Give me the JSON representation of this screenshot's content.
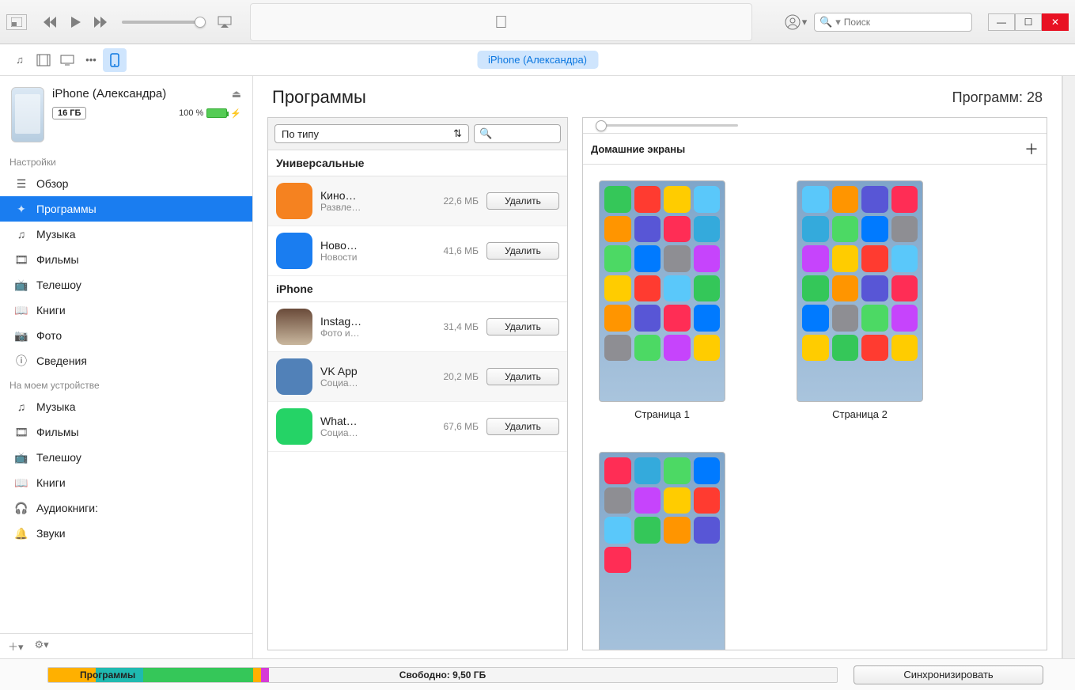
{
  "search_placeholder": "Поиск",
  "device_pill": "iPhone (Александра)",
  "device": {
    "name": "iPhone (Александра)",
    "storage": "16 ГБ",
    "battery_pct": "100 %"
  },
  "sidebar": {
    "settings_header": "Настройки",
    "settings": [
      {
        "label": "Обзор"
      },
      {
        "label": "Программы"
      },
      {
        "label": "Музыка"
      },
      {
        "label": "Фильмы"
      },
      {
        "label": "Телешоу"
      },
      {
        "label": "Книги"
      },
      {
        "label": "Фото"
      },
      {
        "label": "Сведения"
      }
    ],
    "ondevice_header": "На моем устройстве",
    "ondevice": [
      {
        "label": "Музыка"
      },
      {
        "label": "Фильмы"
      },
      {
        "label": "Телешоу"
      },
      {
        "label": "Книги"
      },
      {
        "label": "Аудиокниги:"
      },
      {
        "label": "Звуки"
      }
    ]
  },
  "content": {
    "title": "Программы",
    "count_label": "Программ: 28",
    "sort_label": "По типу",
    "remove_label": "Удалить",
    "groups": [
      {
        "title": "Универсальные",
        "apps": [
          {
            "name": "Кино…",
            "category": "Развле…",
            "size": "22,6 МБ",
            "icon": "ic-orange"
          },
          {
            "name": "Ново…",
            "category": "Новости",
            "size": "41,6 МБ",
            "icon": "ic-blue"
          }
        ]
      },
      {
        "title": "iPhone",
        "apps": [
          {
            "name": "Instag…",
            "category": "Фото и…",
            "size": "31,4 МБ",
            "icon": "ic-insta"
          },
          {
            "name": "VK App",
            "category": "Социа…",
            "size": "20,2 МБ",
            "icon": "ic-vk"
          },
          {
            "name": "What…",
            "category": "Социа…",
            "size": "67,6 МБ",
            "icon": "ic-wa"
          }
        ]
      }
    ],
    "screens_header": "Домашние экраны",
    "screens": [
      {
        "label": "Страница 1"
      },
      {
        "label": "Страница 2"
      },
      {
        "label": ""
      }
    ]
  },
  "bottom": {
    "apps_label": "Программы",
    "free_label": "Свободно: 9,50 ГБ",
    "sync_label": "Синхронизировать",
    "segments": [
      {
        "color": "#d63ad6",
        "w": "1%"
      },
      {
        "color": "#ffb000",
        "w": "1%"
      },
      {
        "color": "#35c759",
        "w": "14%"
      },
      {
        "color": "#1fb9b0",
        "w": "6%"
      },
      {
        "color": "#ffb000",
        "w": "6%"
      }
    ]
  }
}
